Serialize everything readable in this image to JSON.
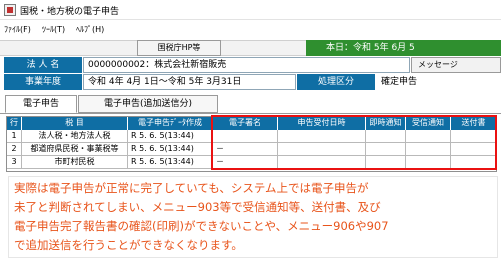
{
  "window": {
    "title": "国税・地方税の電子申告"
  },
  "menu": [
    {
      "label": "ﾌｧｲﾙ(F)"
    },
    {
      "label": "ﾂｰﾙ(T)"
    },
    {
      "label": "ﾍﾙﾌﾟ(H)"
    }
  ],
  "header": {
    "nta_button": "国税庁HP等",
    "date_display": "本日：令和 5年 6月 5"
  },
  "info": {
    "corp_label": "法 人 名",
    "corp_value": "0000000002：株式会社新宿販売",
    "fiscal_label": "事業年度",
    "fiscal_value": "令和 4年 4月 1日～令和 5年 3月31日",
    "category_label": "処理区分",
    "category_value": "確定申告",
    "message_button": "メッセージ"
  },
  "tabs": [
    {
      "label": "電子申告",
      "active": true
    },
    {
      "label": "電子申告(追加送信分)",
      "active": false
    }
  ],
  "grid": {
    "headers": [
      "行",
      "税 目",
      "電子申告ﾃﾞｰﾀ作成",
      "電子署名",
      "申告受付日時",
      "即時通知",
      "受信通知",
      "送付書"
    ],
    "rows": [
      {
        "no": "1",
        "tax": "法人税・地方法人税",
        "created": "R 5. 6. 5(13:44)",
        "signature": "",
        "received": "",
        "instant": "",
        "receipt": "",
        "sent": ""
      },
      {
        "no": "2",
        "tax": "都道府県民税・事業税等",
        "created": "R 5. 6. 5(13:44)",
        "signature": "－",
        "received": "",
        "instant": "",
        "receipt": "",
        "sent": ""
      },
      {
        "no": "3",
        "tax": "市町村民税",
        "created": "R 5. 6. 5(13:44)",
        "signature": "－",
        "received": "",
        "instant": "",
        "receipt": "",
        "sent": ""
      }
    ]
  },
  "annotation": {
    "lines": [
      "実際は電子申告が正常に完了していても、システム上では電子申告が",
      "未了と判断されてしまい、メニュー903等で受信通知等、送付書、及び",
      "電子申告完了報告書の確認(印刷)ができないことや、メニュー906や907",
      "で追加送信を行うことができなくなります。"
    ]
  },
  "colors": {
    "label_blue": "#0f6ea4",
    "date_green": "#2f8f2f",
    "highlight_red": "#ea1111",
    "annotation_orange": "#e8541b"
  }
}
